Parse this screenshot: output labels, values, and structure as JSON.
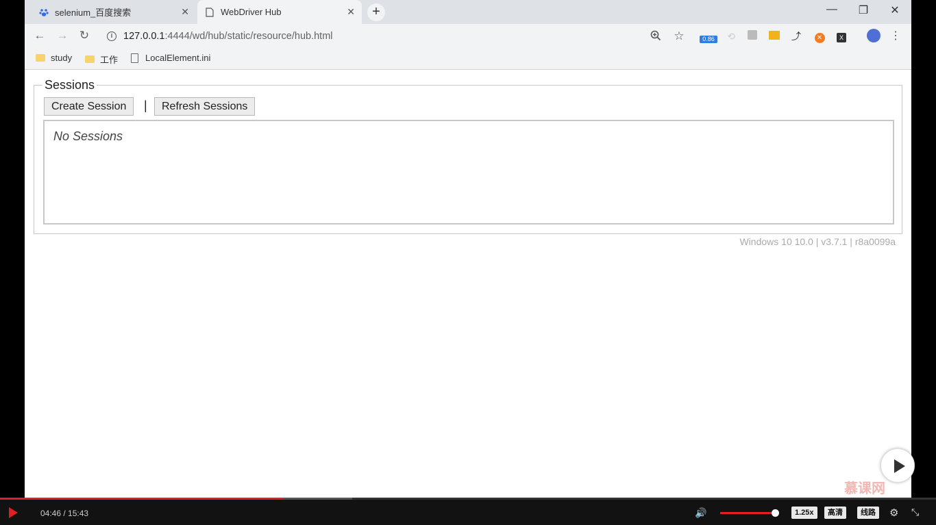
{
  "browser": {
    "tabs": [
      {
        "title": "selenium_百度搜索",
        "active": false
      },
      {
        "title": "WebDriver Hub",
        "active": true
      }
    ],
    "address_bar": {
      "host": "127.0.0.1",
      "path": ":4444/wd/hub/static/resource/hub.html"
    },
    "extension_badge": "0.86",
    "bookmarks": [
      {
        "label": "study",
        "type": "folder"
      },
      {
        "label": "工作",
        "type": "folder"
      },
      {
        "label": "LocalElement.ini",
        "type": "file"
      }
    ]
  },
  "page": {
    "sessions_legend": "Sessions",
    "create_session_label": "Create Session",
    "separator": "|",
    "refresh_sessions_label": "Refresh Sessions",
    "no_sessions_text": "No Sessions",
    "version_info": "Windows 10 10.0  |  v3.7.1  |  r8a0099a"
  },
  "player": {
    "current_time": "04:46",
    "total_time": "15:43",
    "time_display": "04:46 / 15:43",
    "progress_fraction": 0.303,
    "buffer_fraction": 0.376,
    "volume_fraction": 1.0,
    "speed_label": "1.25x",
    "quality_label": "高清",
    "route_label": "线路",
    "watermark": "慕课网",
    "accent_color": "#e02020"
  }
}
